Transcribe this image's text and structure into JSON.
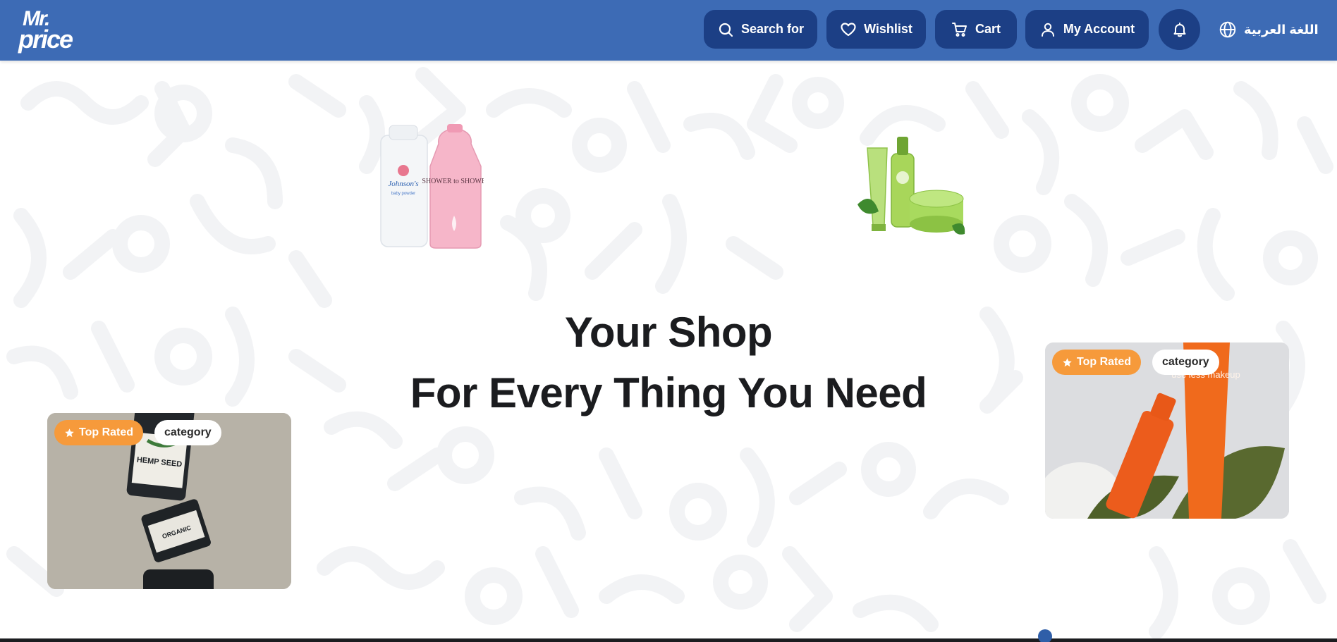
{
  "header": {
    "logo_line1": "Mr.",
    "logo_line2": "price",
    "search_label": "Search for",
    "wishlist_label": "Wishlist",
    "cart_label": "Cart",
    "account_label": "My Account",
    "language_label": "اللغة العربية",
    "icons": [
      "search-icon",
      "heart-icon",
      "cart-icon",
      "user-icon",
      "bell-icon",
      "globe-icon"
    ]
  },
  "hero": {
    "line1": "Your Shop",
    "line2": "For Every Thing You Need"
  },
  "cards": [
    {
      "badge_top": "Top Rated",
      "badge_category": "category"
    },
    {
      "badge_top": "Top Rated",
      "badge_category": "category"
    }
  ],
  "product_labels": {
    "powder_brand": "Johnson's",
    "powder_sub": "baby powder",
    "shower_brand": "SHOWER to SHOWER",
    "hemp_label": "HEMP SEED",
    "jar_label": "ORGANIC",
    "tube_text": "use less makeup"
  },
  "colors": {
    "header_bg": "#3d6bb5",
    "button_bg": "#1c3f85",
    "badge_orange": "#f69a3b",
    "text_dark": "#1b1c1f"
  }
}
